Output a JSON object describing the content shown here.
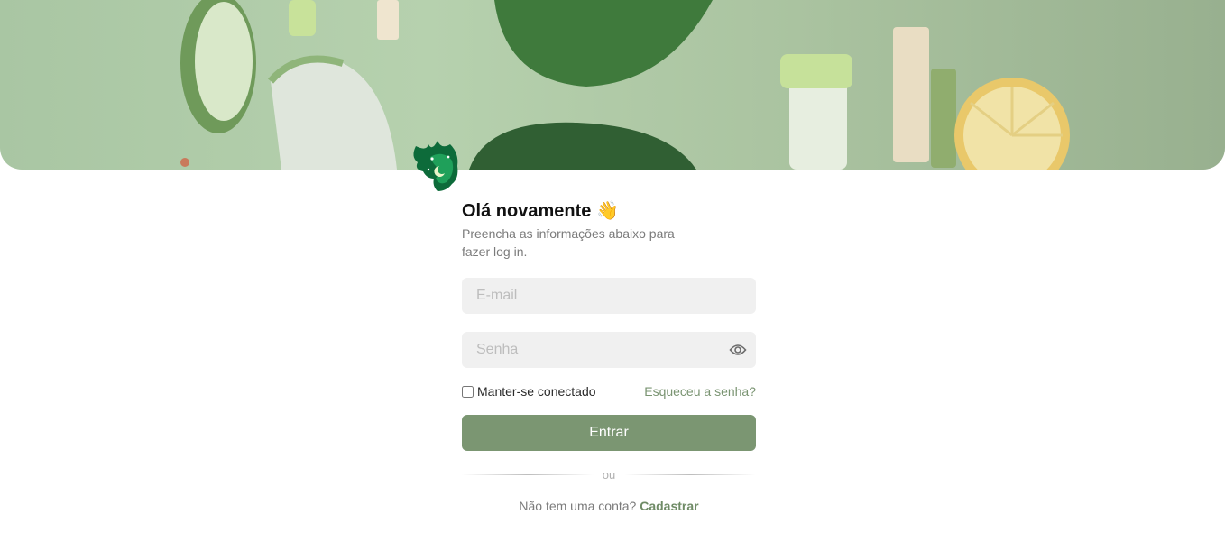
{
  "hero": {
    "image_description_icon": "vegetables-banner-image"
  },
  "logo": {
    "icon": "green-tree-head-logo"
  },
  "login": {
    "title": "Olá novamente",
    "title_emoji": "👋",
    "subtitle": "Preencha as informações abaixo para fazer log in.",
    "email_placeholder": "E-mail",
    "email_value": "",
    "password_placeholder": "Senha",
    "password_value": "",
    "show_password_icon": "eye-icon",
    "remember_label": "Manter-se conectado",
    "remember_checked": false,
    "forgot_label": "Esqueceu a senha?",
    "submit_label": "Entrar",
    "divider_label": "ou",
    "signup_prompt": "Não tem uma conta?",
    "signup_link": "Cadastrar"
  },
  "colors": {
    "accent": "#7b9672",
    "link": "#7a9472",
    "field_bg": "#f0f0f0",
    "hero_green": "#b6d1ae"
  }
}
